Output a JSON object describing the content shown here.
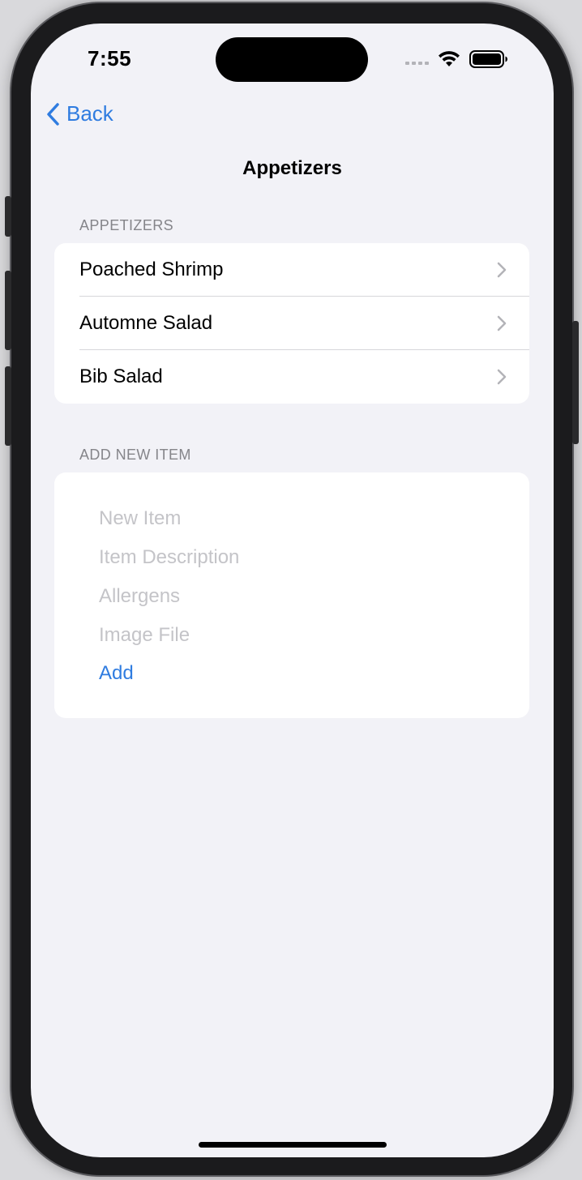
{
  "status_bar": {
    "time": "7:55",
    "signal_icon": "signal-dots-icon",
    "wifi_icon": "wifi-icon",
    "battery_icon": "battery-icon"
  },
  "nav": {
    "back_label": "Back",
    "title": "Appetizers"
  },
  "appetizers_section": {
    "header": "APPETIZERS",
    "items": [
      {
        "label": "Poached Shrimp"
      },
      {
        "label": "Automne Salad"
      },
      {
        "label": "Bib Salad"
      }
    ]
  },
  "add_section": {
    "header": "ADD NEW ITEM",
    "fields": {
      "name_placeholder": "New Item",
      "description_placeholder": "Item Description",
      "allergens_placeholder": "Allergens",
      "image_placeholder": "Image File"
    },
    "add_label": "Add"
  },
  "colors": {
    "accent": "#2f7ce0",
    "background": "#f2f2f7",
    "card": "#ffffff",
    "secondary_text": "#85858a",
    "placeholder": "#c4c4c8"
  }
}
